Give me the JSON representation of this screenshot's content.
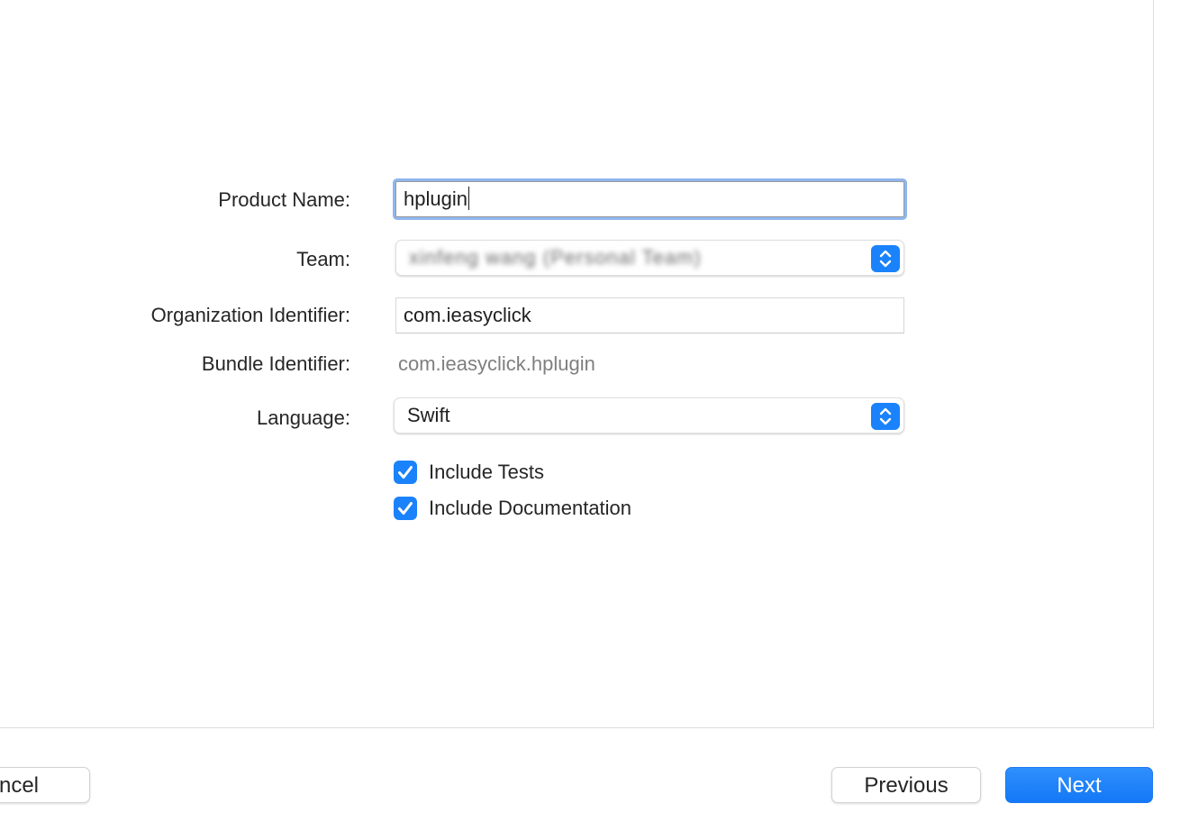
{
  "form": {
    "product_name": {
      "label": "Product Name:",
      "value": "hplugin"
    },
    "team": {
      "label": "Team:",
      "value": "xinfeng wang (Personal Team)"
    },
    "organization_identifier": {
      "label": "Organization Identifier:",
      "value": "com.ieasyclick"
    },
    "bundle_identifier": {
      "label": "Bundle Identifier:",
      "value": "com.ieasyclick.hplugin"
    },
    "language": {
      "label": "Language:",
      "value": "Swift"
    },
    "include_tests": {
      "label": "Include Tests",
      "checked": true
    },
    "include_documentation": {
      "label": "Include Documentation",
      "checked": true
    }
  },
  "footer": {
    "cancel_label": "ncel",
    "previous_label": "Previous",
    "next_label": "Next"
  },
  "colors": {
    "accent": "#1a82fb",
    "focus_ring": "#8fb6ee"
  },
  "icons": {
    "popup": "chevron-up-down-icon",
    "checkbox": "checkmark-icon"
  }
}
